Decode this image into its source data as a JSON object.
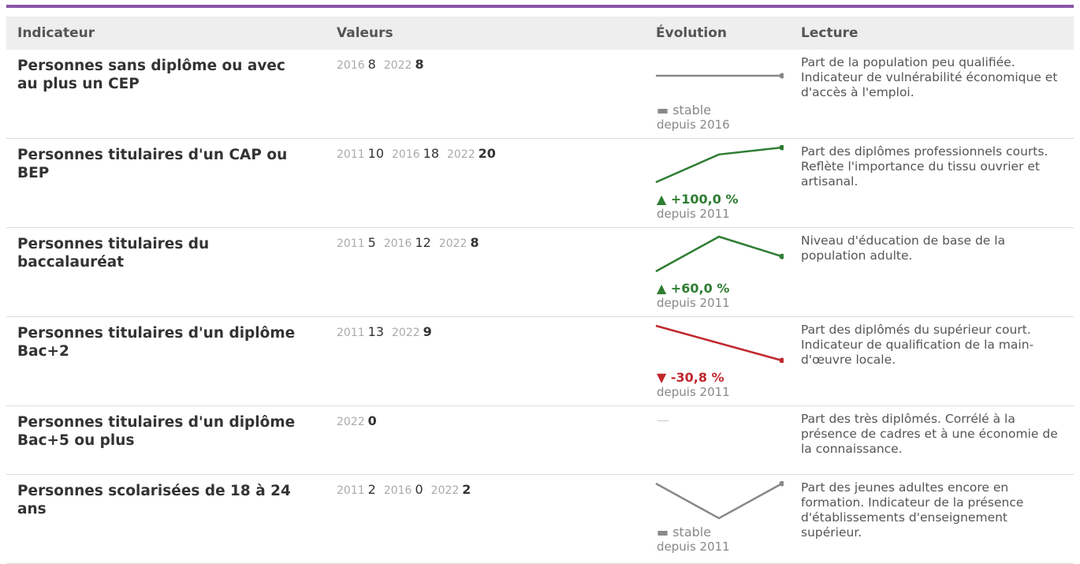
{
  "table": {
    "headers": {
      "indicator": "Indicateur",
      "values": "Valeurs",
      "evolution": "Évolution",
      "reading": "Lecture"
    },
    "rows": [
      {
        "indicator": "Personnes sans diplôme ou avec au plus un CEP",
        "values": [
          {
            "year": "2016",
            "value": "8"
          },
          {
            "year": "2022",
            "value": "8"
          }
        ],
        "trend": {
          "direction": "flat",
          "label": "▬ stable",
          "since": "depuis 2016"
        },
        "spark": [
          8,
          8
        ],
        "reading": "Part de la population peu qualifiée. Indicateur de vulnérabilité économique et d'accès à l'emploi."
      },
      {
        "indicator": "Personnes titulaires d'un CAP ou BEP",
        "values": [
          {
            "year": "2011",
            "value": "10"
          },
          {
            "year": "2016",
            "value": "18"
          },
          {
            "year": "2022",
            "value": "20"
          }
        ],
        "trend": {
          "direction": "up",
          "label": "▲ +100,0 %",
          "since": "depuis 2011"
        },
        "spark": [
          10,
          18,
          20
        ],
        "reading": "Part des diplômes professionnels courts. Reflète l'importance du tissu ouvrier et artisanal."
      },
      {
        "indicator": "Personnes titulaires du baccalauréat",
        "values": [
          {
            "year": "2011",
            "value": "5"
          },
          {
            "year": "2016",
            "value": "12"
          },
          {
            "year": "2022",
            "value": "8"
          }
        ],
        "trend": {
          "direction": "up",
          "label": "▲ +60,0 %",
          "since": "depuis 2011"
        },
        "spark": [
          5,
          12,
          8
        ],
        "reading": "Niveau d'éducation de base de la population adulte."
      },
      {
        "indicator": "Personnes titulaires d'un diplôme Bac+2",
        "values": [
          {
            "year": "2011",
            "value": "13"
          },
          {
            "year": "2022",
            "value": "9"
          }
        ],
        "trend": {
          "direction": "down",
          "label": "▼ -30,8 %",
          "since": "depuis 2011"
        },
        "spark": [
          13,
          9
        ],
        "reading": "Part des diplômés du supérieur court. Indicateur de qualification de la main-d'œuvre locale."
      },
      {
        "indicator": "Personnes titulaires d'un diplôme Bac+5 ou plus",
        "values": [
          {
            "year": "2022",
            "value": "0"
          }
        ],
        "trend": {
          "direction": "none",
          "label": "—",
          "since": ""
        },
        "spark": [],
        "reading": "Part des très diplômés. Corrélé à la présence de cadres et à une économie de la connaissance."
      },
      {
        "indicator": "Personnes scolarisées de 18 à 24 ans",
        "values": [
          {
            "year": "2011",
            "value": "2"
          },
          {
            "year": "2016",
            "value": "0"
          },
          {
            "year": "2022",
            "value": "2"
          }
        ],
        "trend": {
          "direction": "flat",
          "label": "▬ stable",
          "since": "depuis 2011"
        },
        "spark": [
          2,
          0,
          2
        ],
        "reading": "Part des jeunes adultes encore en formation. Indicateur de la présence d'établissements d'enseignement supérieur."
      }
    ]
  },
  "colors": {
    "accent_bar": "#8a55a8",
    "up": "#2e7d32",
    "down": "#c0272d",
    "flat": "#888888"
  }
}
